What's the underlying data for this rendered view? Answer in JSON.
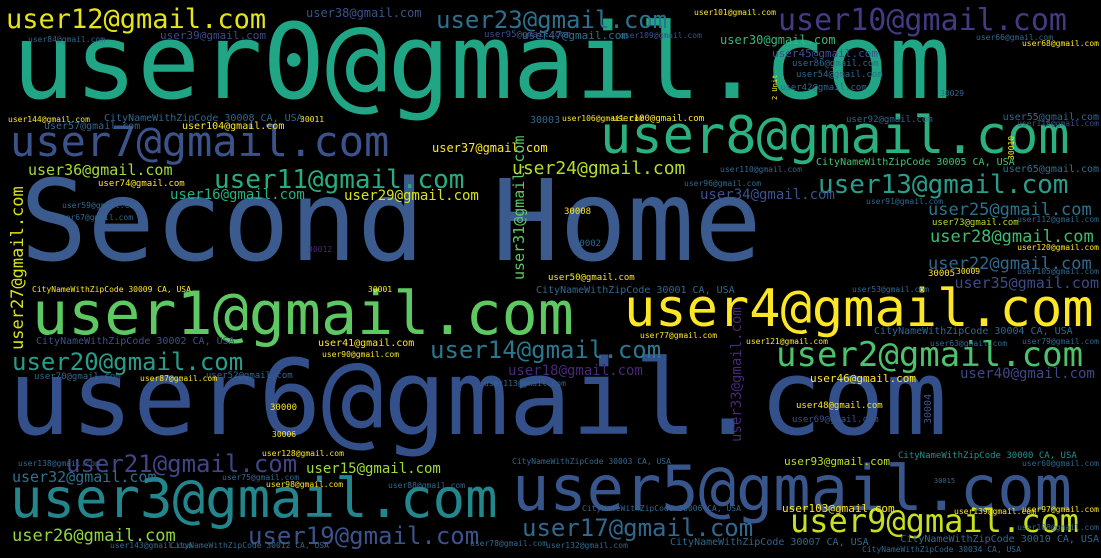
{
  "palette": {
    "yellow": "#fde725",
    "green": "#5ec962",
    "lime": "#7ad151",
    "teal": "#21918c",
    "teal2": "#1f9e89",
    "blue": "#3b528b",
    "blue2": "#31688e",
    "purple": "#440154",
    "purple2": "#482878",
    "background": "#000000"
  },
  "words": [
    {
      "id": "w0",
      "text": "user0@gmail.com",
      "color": "#21a685"
    },
    {
      "id": "w1",
      "text": "Second Home",
      "color": "#3b5b8e"
    },
    {
      "id": "w2",
      "text": "user6@gmail.com",
      "color": "#33508a"
    },
    {
      "id": "w3",
      "text": "user1@gmail.com",
      "color": "#5ec962"
    },
    {
      "id": "w4",
      "text": "user8@gmail.com",
      "color": "#2bb07f"
    },
    {
      "id": "w5",
      "text": "user4@gmail.com",
      "color": "#fde725"
    },
    {
      "id": "w6",
      "text": "user5@gmail.com",
      "color": "#39568c"
    },
    {
      "id": "w7",
      "text": "user3@gmail.com",
      "color": "#23868c"
    },
    {
      "id": "w8",
      "text": "user7@gmail.com",
      "color": "#3b528b"
    },
    {
      "id": "w9",
      "text": "user12@gmail.com",
      "color": "#e5e419"
    },
    {
      "id": "w10",
      "text": "user23@gmail.com",
      "color": "#2c728e"
    },
    {
      "id": "w11",
      "text": "user10@gmail.com",
      "color": "#443a83"
    },
    {
      "id": "w12",
      "text": "user13@gmail.com",
      "color": "#2a9d8a"
    },
    {
      "id": "w13",
      "text": "user2@gmail.com",
      "color": "#4cc26c"
    },
    {
      "id": "w14",
      "text": "user9@gmail.com",
      "color": "#c8e020"
    },
    {
      "id": "w15",
      "text": "user11@gmail.com",
      "color": "#27ad81"
    },
    {
      "id": "w16",
      "text": "user14@gmail.com",
      "color": "#2a788e"
    },
    {
      "id": "w17",
      "text": "user20@gmail.com",
      "color": "#2a9d8a"
    },
    {
      "id": "w18",
      "text": "user21@gmail.com",
      "color": "#414487"
    },
    {
      "id": "w19",
      "text": "user17@gmail.com",
      "color": "#31688e"
    },
    {
      "id": "w20",
      "text": "user19@gmail.com",
      "color": "#3b528b"
    },
    {
      "id": "w21",
      "text": "user24@gmail.com",
      "color": "#b5de2b"
    },
    {
      "id": "w22",
      "text": "user25@gmail.com",
      "color": "#2c728e"
    },
    {
      "id": "w23",
      "text": "user28@gmail.com",
      "color": "#3dbc74"
    },
    {
      "id": "w24",
      "text": "user22@gmail.com",
      "color": "#31688e"
    },
    {
      "id": "w25",
      "text": "user35@gmail.com",
      "color": "#3e4a89"
    },
    {
      "id": "w26",
      "text": "user40@gmail.com",
      "color": "#3f4788"
    },
    {
      "id": "w27",
      "text": "user36@gmail.com",
      "color": "#a0da39"
    },
    {
      "id": "w28",
      "text": "user16@gmail.com",
      "color": "#29af7f"
    },
    {
      "id": "w29",
      "text": "user29@gmail.com",
      "color": "#d8e219"
    },
    {
      "id": "w30",
      "text": "user34@gmail.com",
      "color": "#3b528b"
    },
    {
      "id": "w31",
      "text": "user32@gmail.com",
      "color": "#2c728e"
    },
    {
      "id": "w32",
      "text": "user26@gmail.com",
      "color": "#90d743"
    },
    {
      "id": "w33",
      "text": "user15@gmail.com",
      "color": "#9fda3a"
    },
    {
      "id": "w34",
      "text": "user18@gmail.com",
      "color": "#482878"
    },
    {
      "id": "w35",
      "text": "user37@gmail.com",
      "color": "#fde725"
    },
    {
      "id": "w36",
      "text": "user38@gmail.com",
      "color": "#3b528b"
    },
    {
      "id": "w37",
      "text": "user39@gmail.com",
      "color": "#3e4a89"
    },
    {
      "id": "w38",
      "text": "user30@gmail.com",
      "color": "#35b779"
    },
    {
      "id": "w39",
      "text": "user47@gmail.com",
      "color": "#2c728e"
    },
    {
      "id": "w40",
      "text": "user41@gmail.com",
      "color": "#fde725"
    },
    {
      "id": "w41",
      "text": "user46@gmail.com",
      "color": "#fde725"
    },
    {
      "id": "w42",
      "text": "user45@gmail.com",
      "color": "#3b528b"
    },
    {
      "id": "w43",
      "text": "user27@gmail.com",
      "color": "#d8e219"
    },
    {
      "id": "w44",
      "text": "user31@gmail.com",
      "color": "#5ec962"
    },
    {
      "id": "w45",
      "text": "user33@gmail.com",
      "color": "#482878"
    },
    {
      "id": "w46",
      "text": "user93@gmail.com",
      "color": "#bddf26"
    },
    {
      "id": "w47",
      "text": "user103@gmail.com",
      "color": "#fde725"
    },
    {
      "id": "w48",
      "text": "user48@gmail.com",
      "color": "#fde725"
    },
    {
      "id": "w49",
      "text": "user69@gmail.com",
      "color": "#3b528b"
    },
    {
      "id": "w50",
      "text": "user65@gmail.com",
      "color": "#2c728e"
    },
    {
      "id": "w51",
      "text": "user55@gmail.com",
      "color": "#31688e"
    },
    {
      "id": "w52",
      "text": "user73@gmail.com",
      "color": "#bddf26"
    },
    {
      "id": "w53",
      "text": "user100@gmail.com",
      "color": "#fde725"
    },
    {
      "id": "w54",
      "text": "user54@gmail.com",
      "color": "#31688e"
    },
    {
      "id": "w55",
      "text": "user86@gmail.com",
      "color": "#31688e"
    },
    {
      "id": "w56",
      "text": "user42@gmail.com",
      "color": "#31688e"
    },
    {
      "id": "w57",
      "text": "user92@gmail.com",
      "color": "#31688e"
    },
    {
      "id": "w58",
      "text": "user95@gmail.com",
      "color": "#3b528b"
    },
    {
      "id": "w59",
      "text": "user101@gmail.com",
      "color": "#fde725"
    },
    {
      "id": "w60",
      "text": "user84@gmail.com",
      "color": "#31688e"
    },
    {
      "id": "w61",
      "text": "user57@gmail.com",
      "color": "#31688e"
    },
    {
      "id": "w62",
      "text": "user104@gmail.com",
      "color": "#fde725"
    },
    {
      "id": "w63",
      "text": "user144@gmail.com",
      "color": "#fde725"
    },
    {
      "id": "w64",
      "text": "user74@gmail.com",
      "color": "#fde725"
    },
    {
      "id": "w65",
      "text": "user59@gmail.com",
      "color": "#31688e"
    },
    {
      "id": "w66",
      "text": "user67@gmail.com",
      "color": "#31688e"
    },
    {
      "id": "w67",
      "text": "user106@gmail.com",
      "color": "#fde725"
    },
    {
      "id": "w68",
      "text": "user50@gmail.com",
      "color": "#fde725"
    },
    {
      "id": "w69",
      "text": "user70@gmail.com",
      "color": "#31688e"
    },
    {
      "id": "w70",
      "text": "user52@gmail.com",
      "color": "#31688e"
    },
    {
      "id": "w71",
      "text": "user87@gmail.com",
      "color": "#fde725"
    },
    {
      "id": "w72",
      "text": "user90@gmail.com",
      "color": "#fde725"
    },
    {
      "id": "w73",
      "text": "user60@gmail.com",
      "color": "#31688e"
    },
    {
      "id": "w74",
      "text": "user75@gmail.com",
      "color": "#31688e"
    },
    {
      "id": "w75",
      "text": "user88@gmail.com",
      "color": "#31688e"
    },
    {
      "id": "w76",
      "text": "user78@gmail.com",
      "color": "#31688e"
    },
    {
      "id": "w77",
      "text": "user66@gmail.com",
      "color": "#31688e"
    },
    {
      "id": "w78",
      "text": "user109@gmail.com",
      "color": "#3b528b"
    },
    {
      "id": "w79",
      "text": "user116@gmail.com",
      "color": "#3b528b"
    },
    {
      "id": "w80",
      "text": "user79@gmail.com",
      "color": "#31688e"
    },
    {
      "id": "w81",
      "text": "user63@gmail.com",
      "color": "#31688e"
    },
    {
      "id": "w82",
      "text": "user77@gmail.com",
      "color": "#fde725"
    },
    {
      "id": "w83",
      "text": "user53@gmail.com",
      "color": "#31688e"
    },
    {
      "id": "w84",
      "text": "user121@gmail.com",
      "color": "#fde725"
    },
    {
      "id": "w85",
      "text": "user98@gmail.com",
      "color": "#fde725"
    },
    {
      "id": "w86",
      "text": "user68@gmail.com",
      "color": "#fde725"
    },
    {
      "id": "w87",
      "text": "user96@gmail.com",
      "color": "#31688e"
    },
    {
      "id": "w88",
      "text": "user91@gmail.com",
      "color": "#31688e"
    },
    {
      "id": "w89",
      "text": "user110@gmail.com",
      "color": "#31688e"
    },
    {
      "id": "w90",
      "text": "user120@gmail.com",
      "color": "#fde725"
    },
    {
      "id": "w91",
      "text": "user105@gmail.com",
      "color": "#31688e"
    },
    {
      "id": "w92",
      "text": "user112@gmail.com",
      "color": "#31688e"
    },
    {
      "id": "w93",
      "text": "user139@gmail.com",
      "color": "#fde725"
    },
    {
      "id": "w94",
      "text": "user138@gmail.com",
      "color": "#31688e"
    },
    {
      "id": "w95",
      "text": "user97@gmail.com",
      "color": "#fde725"
    },
    {
      "id": "w96",
      "text": "user108@gmail.com",
      "color": "#31688e"
    },
    {
      "id": "w97",
      "text": "user113@gmail.com",
      "color": "#31688e"
    },
    {
      "id": "w98",
      "text": "user128@gmail.com",
      "color": "#fde725"
    },
    {
      "id": "w99",
      "text": "user132@gmail.com",
      "color": "#31688e"
    },
    {
      "id": "w100",
      "text": "user143@gmail.com",
      "color": "#31688e"
    },
    {
      "id": "w101",
      "text": "CityNameWithZipCode 30005 CA, USA",
      "color": "#4ac16d"
    },
    {
      "id": "w102",
      "text": "CityNameWithZipCode 30009 CA, USA",
      "color": "#fde725"
    },
    {
      "id": "w103",
      "text": "CityNameWithZipCode 30002 CA, USA",
      "color": "#3b528b"
    },
    {
      "id": "w104",
      "text": "CityNameWithZipCode 30001 CA, USA",
      "color": "#31688e"
    },
    {
      "id": "w105",
      "text": "CityNameWithZipCode 30004 CA, USA",
      "color": "#31688e"
    },
    {
      "id": "w106",
      "text": "CityNameWithZipCode 30003 CA, USA",
      "color": "#31688e"
    },
    {
      "id": "w107",
      "text": "CityNameWithZipCode 30006 CA, USA",
      "color": "#31688e"
    },
    {
      "id": "w108",
      "text": "CityNameWithZipCode 30007 CA, USA",
      "color": "#31688e"
    },
    {
      "id": "w109",
      "text": "CityNameWithZipCode 30000 CA, USA",
      "color": "#21918c"
    },
    {
      "id": "w110",
      "text": "CityNameWithZipCode 30008 CA, USA",
      "color": "#31688e"
    },
    {
      "id": "w111",
      "text": "CityNameWithZipCode 30012 CA, USA",
      "color": "#31688e"
    },
    {
      "id": "w112",
      "text": "CityNameWithZipCode 30010 CA, USA",
      "color": "#31688e"
    },
    {
      "id": "w113",
      "text": "CityNameWithZipCode 30034 CA, USA",
      "color": "#31688e"
    },
    {
      "id": "w114",
      "text": "30003",
      "color": "#31688e"
    },
    {
      "id": "w115",
      "text": "30008",
      "color": "#fde725"
    },
    {
      "id": "w116",
      "text": "30002",
      "color": "#31688e"
    },
    {
      "id": "w117",
      "text": "30001",
      "color": "#fde725"
    },
    {
      "id": "w118",
      "text": "30000",
      "color": "#fde725"
    },
    {
      "id": "w119",
      "text": "30006",
      "color": "#fde725"
    },
    {
      "id": "w120",
      "text": "30011",
      "color": "#fde725"
    },
    {
      "id": "w121",
      "text": "30005",
      "color": "#fde725"
    },
    {
      "id": "w122",
      "text": "30009",
      "color": "#fde725"
    },
    {
      "id": "w123",
      "text": "30004",
      "color": "#3b528b"
    },
    {
      "id": "w124",
      "text": "30029",
      "color": "#31688e"
    },
    {
      "id": "w125",
      "text": "30010",
      "color": "#fde725"
    },
    {
      "id": "w126",
      "text": "30012",
      "color": "#482878"
    },
    {
      "id": "w127",
      "text": "30015",
      "color": "#31688e"
    },
    {
      "id": "w128",
      "text": "2 Unit",
      "color": "#fde725"
    }
  ]
}
